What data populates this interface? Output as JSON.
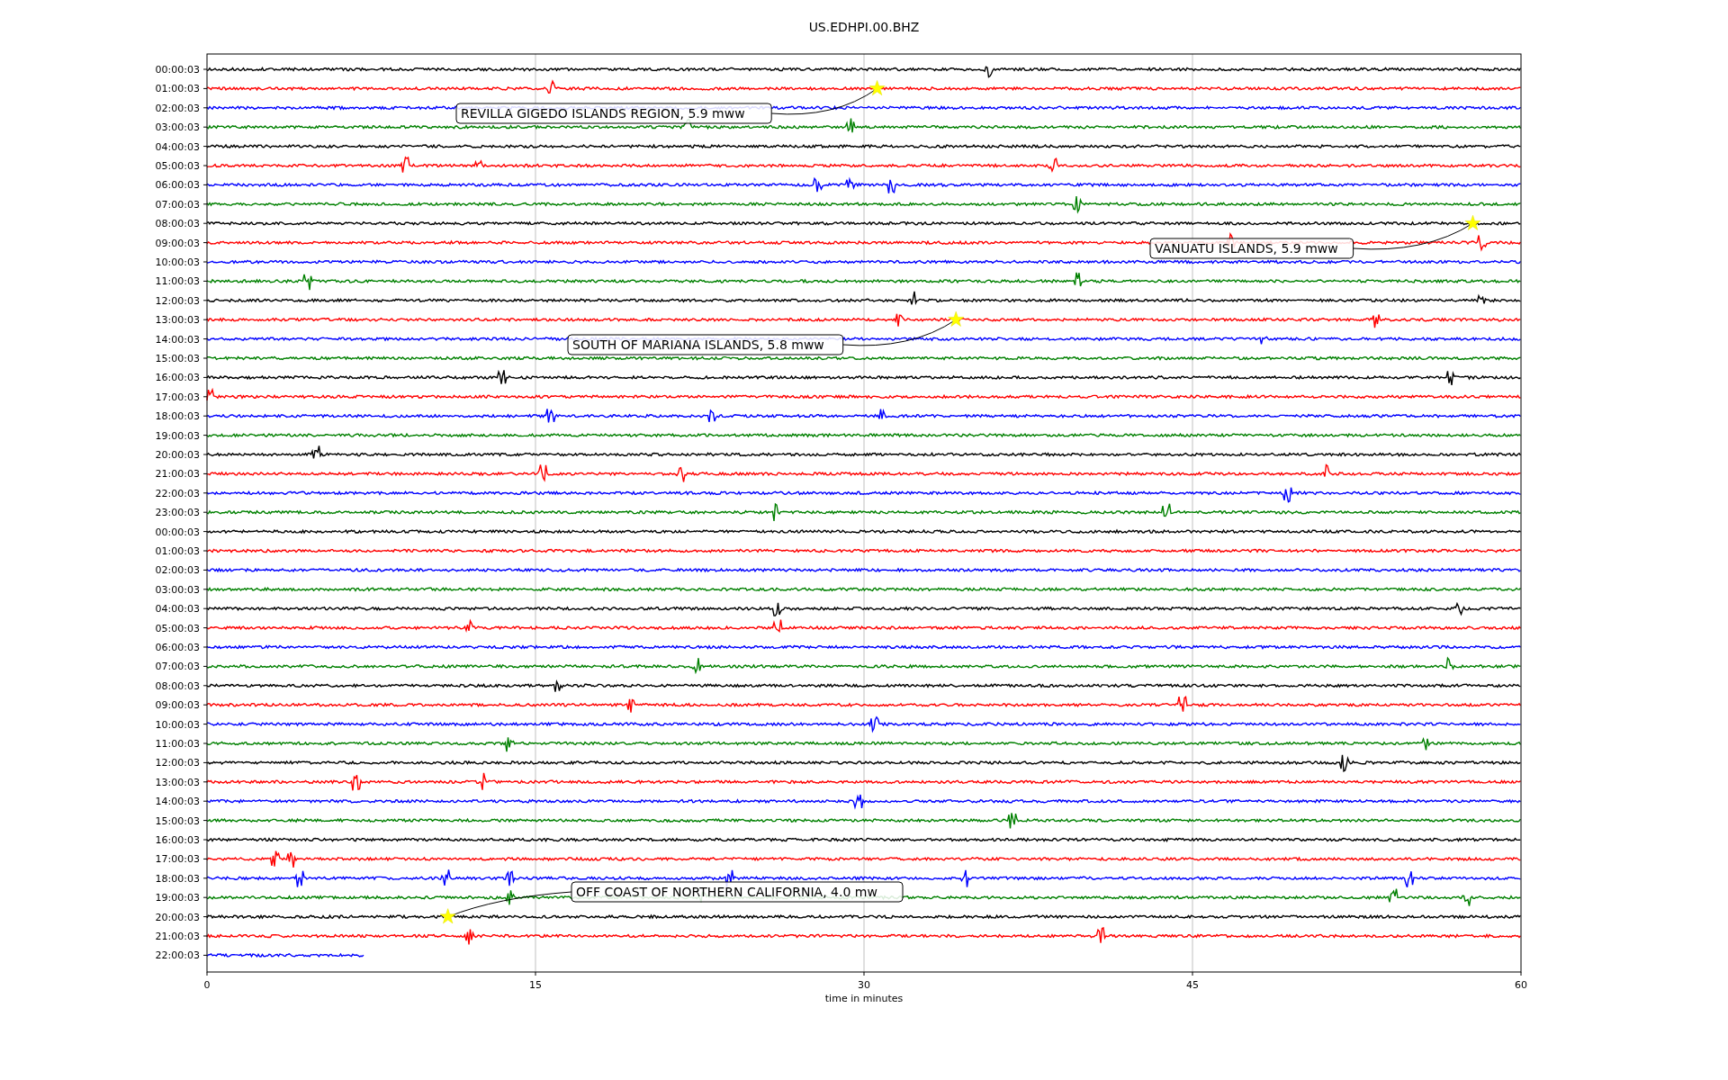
{
  "title": "US.EDHPI.00.BHZ",
  "traces": [
    {
      "label": "00:00:03",
      "color": "#000000",
      "level": 1
    },
    {
      "label": "01:00:03",
      "color": "#ff0000",
      "level": 1
    },
    {
      "label": "02:00:03",
      "color": "#0000ff",
      "level": 1
    },
    {
      "label": "03:00:03",
      "color": "#008000",
      "level": 1
    },
    {
      "label": "04:00:03",
      "color": "#000000",
      "level": 1
    },
    {
      "label": "05:00:03",
      "color": "#ff0000",
      "level": 1
    },
    {
      "label": "06:00:03",
      "color": "#0000ff",
      "level": 1
    },
    {
      "label": "07:00:03",
      "color": "#008000",
      "level": 1
    },
    {
      "label": "08:00:03",
      "color": "#000000",
      "level": 1
    },
    {
      "label": "09:00:03",
      "color": "#ff0000",
      "level": 1
    },
    {
      "label": "10:00:03",
      "color": "#0000ff",
      "level": 1
    },
    {
      "label": "11:00:03",
      "color": "#008000",
      "level": 1
    },
    {
      "label": "12:00:03",
      "color": "#000000",
      "level": 1
    },
    {
      "label": "13:00:03",
      "color": "#ff0000",
      "level": 1
    },
    {
      "label": "14:00:03",
      "color": "#0000ff",
      "level": 1
    },
    {
      "label": "15:00:03",
      "color": "#008000",
      "level": 1
    },
    {
      "label": "16:00:03",
      "color": "#000000",
      "level": 1
    },
    {
      "label": "17:00:03",
      "color": "#ff0000",
      "level": 1
    },
    {
      "label": "18:00:03",
      "color": "#0000ff",
      "level": 1
    },
    {
      "label": "19:00:03",
      "color": "#008000",
      "level": 1
    },
    {
      "label": "20:00:03",
      "color": "#000000",
      "level": 1
    },
    {
      "label": "21:00:03",
      "color": "#ff0000",
      "level": 1
    },
    {
      "label": "22:00:03",
      "color": "#0000ff",
      "level": 1
    },
    {
      "label": "23:00:03",
      "color": "#008000",
      "level": 1
    },
    {
      "label": "00:00:03",
      "color": "#000000",
      "level": 1
    },
    {
      "label": "01:00:03",
      "color": "#ff0000",
      "level": 1
    },
    {
      "label": "02:00:03",
      "color": "#0000ff",
      "level": 1
    },
    {
      "label": "03:00:03",
      "color": "#008000",
      "level": 1
    },
    {
      "label": "04:00:03",
      "color": "#000000",
      "level": 1
    },
    {
      "label": "05:00:03",
      "color": "#ff0000",
      "level": 1
    },
    {
      "label": "06:00:03",
      "color": "#0000ff",
      "level": 1
    },
    {
      "label": "07:00:03",
      "color": "#008000",
      "level": 1
    },
    {
      "label": "08:00:03",
      "color": "#000000",
      "level": 1
    },
    {
      "label": "09:00:03",
      "color": "#ff0000",
      "level": 1
    },
    {
      "label": "10:00:03",
      "color": "#0000ff",
      "level": 1
    },
    {
      "label": "11:00:03",
      "color": "#008000",
      "level": 1
    },
    {
      "label": "12:00:03",
      "color": "#000000",
      "level": 1
    },
    {
      "label": "13:00:03",
      "color": "#ff0000",
      "level": 1
    },
    {
      "label": "14:00:03",
      "color": "#0000ff",
      "level": 1
    },
    {
      "label": "15:00:03",
      "color": "#008000",
      "level": 1
    },
    {
      "label": "16:00:03",
      "color": "#000000",
      "level": 1
    },
    {
      "label": "17:00:03",
      "color": "#ff0000",
      "level": 1
    },
    {
      "label": "18:00:03",
      "color": "#0000ff",
      "level": 1
    },
    {
      "label": "19:00:03",
      "color": "#008000",
      "level": 1
    },
    {
      "label": "20:00:03",
      "color": "#000000",
      "level": 1
    },
    {
      "label": "21:00:03",
      "color": "#ff0000",
      "level": 1
    },
    {
      "label": "22:00:03",
      "color": "#0000ff",
      "level": 0.12
    }
  ],
  "x_ticks": [
    "0",
    "15",
    "30",
    "45",
    "60"
  ],
  "x_label": "time in minutes",
  "events": [
    {
      "text": "REVILLA GIGEDO ISLANDS REGION, 5.9 mww"
    },
    {
      "text": "VANUATU ISLANDS, 5.9 mww"
    },
    {
      "text": "SOUTH OF MARIANA ISLANDS, 5.8 mww"
    },
    {
      "text": "OFF COAST OF NORTHERN CALIFORNIA, 4.0 mw"
    }
  ]
}
